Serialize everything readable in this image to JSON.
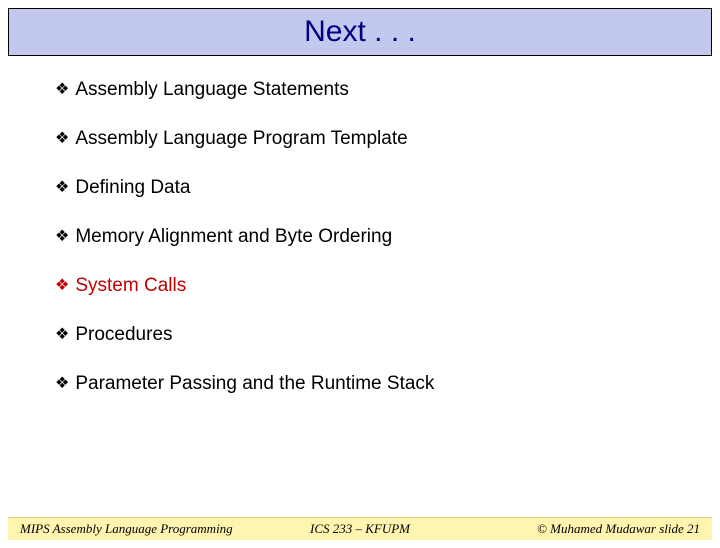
{
  "title": "Next . . .",
  "items": [
    {
      "label": "Assembly Language Statements",
      "active": false
    },
    {
      "label": "Assembly Language Program Template",
      "active": false
    },
    {
      "label": "Defining Data",
      "active": false
    },
    {
      "label": "Memory Alignment and Byte Ordering",
      "active": false
    },
    {
      "label": "System Calls",
      "active": true
    },
    {
      "label": "Procedures",
      "active": false
    },
    {
      "label": "Parameter Passing and the Runtime Stack",
      "active": false
    }
  ],
  "footer": {
    "left": "MIPS Assembly Language Programming",
    "center": "ICS 233 – KFUPM",
    "right": "© Muhamed Mudawar   slide 21"
  }
}
